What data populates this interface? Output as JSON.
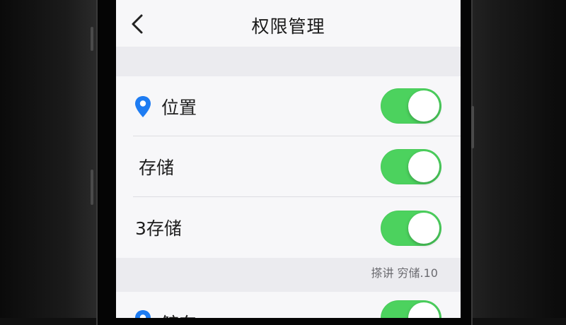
{
  "nav": {
    "title": "权限管理",
    "back_icon": "chevron-left-icon"
  },
  "permissions": [
    {
      "label": "位置",
      "icon": "location-pin-icon",
      "enabled": true
    },
    {
      "label": "存储",
      "enabled": true
    },
    {
      "label": "3存储",
      "enabled": true
    },
    {
      "label": "鲸东",
      "icon": "location-pin-icon",
      "enabled": true
    }
  ],
  "footnote": "搽讲 穷储.10",
  "colors": {
    "toggle_on": "#4cd25e",
    "pin_icon": "#1e7cf2",
    "screen_bg": "#f3f3f5"
  }
}
